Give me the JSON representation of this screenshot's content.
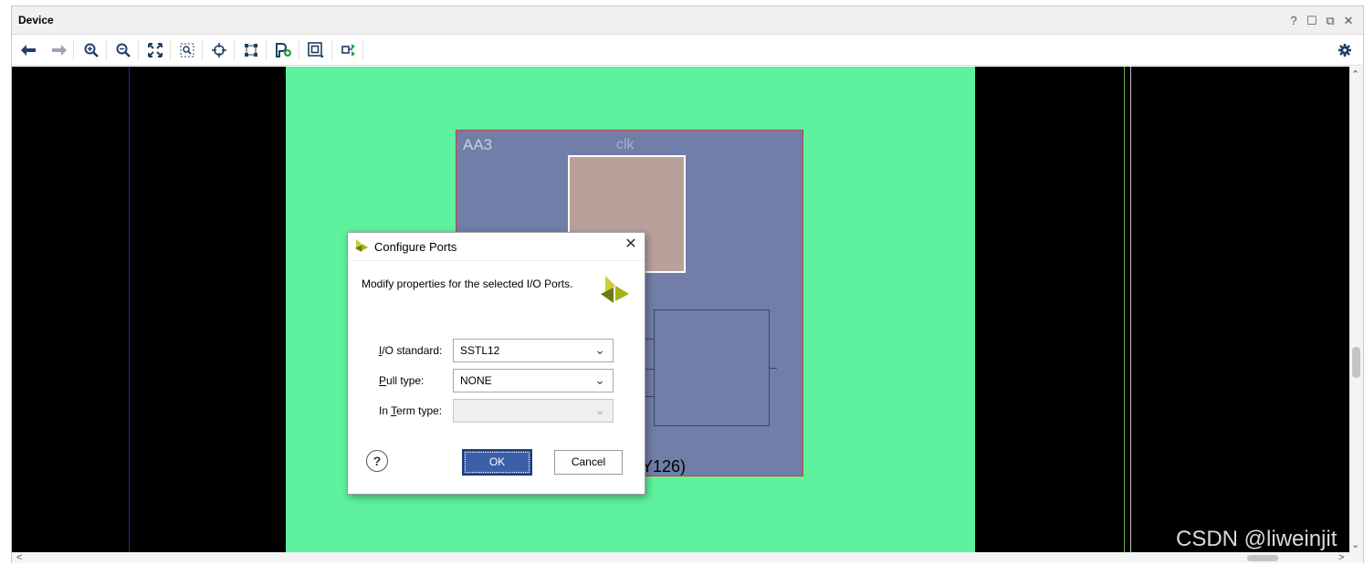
{
  "window": {
    "title": "Device",
    "controls": {
      "help": "?",
      "maximize": "☐",
      "float": "⧉",
      "close": "✕"
    }
  },
  "toolbar": {
    "icons": [
      "back-arrow-icon",
      "forward-arrow-icon",
      "zoom-in-icon",
      "zoom-out-icon",
      "zoom-fit-icon",
      "zoom-selection-icon",
      "auto-fit-crosshair-icon",
      "routing-resources-icon",
      "place-ports-icon",
      "pblock-icon",
      "autoplace-icon",
      "settings-gear-icon"
    ]
  },
  "canvas": {
    "site_name": "AA3",
    "port_name": "clk",
    "site_coord_partial": "Y126)",
    "colors": {
      "background": "#000000",
      "region": "#5ef29e",
      "site": "#707ea8",
      "site_border": "#d23c3c",
      "pad": "#b9a09b"
    }
  },
  "dialog": {
    "title": "Configure Ports",
    "description": "Modify properties for the selected I/O Ports.",
    "fields": [
      {
        "label_prefix": "",
        "label_mnemonic": "I",
        "label_rest": "/O standard:",
        "value": "SSTL12",
        "enabled": true
      },
      {
        "label_prefix": "",
        "label_mnemonic": "P",
        "label_rest": "ull type:",
        "value": "NONE",
        "enabled": true
      },
      {
        "label_prefix": "In ",
        "label_mnemonic": "T",
        "label_rest": "erm type:",
        "value": "",
        "enabled": false
      }
    ],
    "help_label": "?",
    "ok_label": "OK",
    "cancel_label": "Cancel",
    "close_label": "✕",
    "accent": "#3b5fa8"
  },
  "watermark": "CSDN @liweinjit"
}
